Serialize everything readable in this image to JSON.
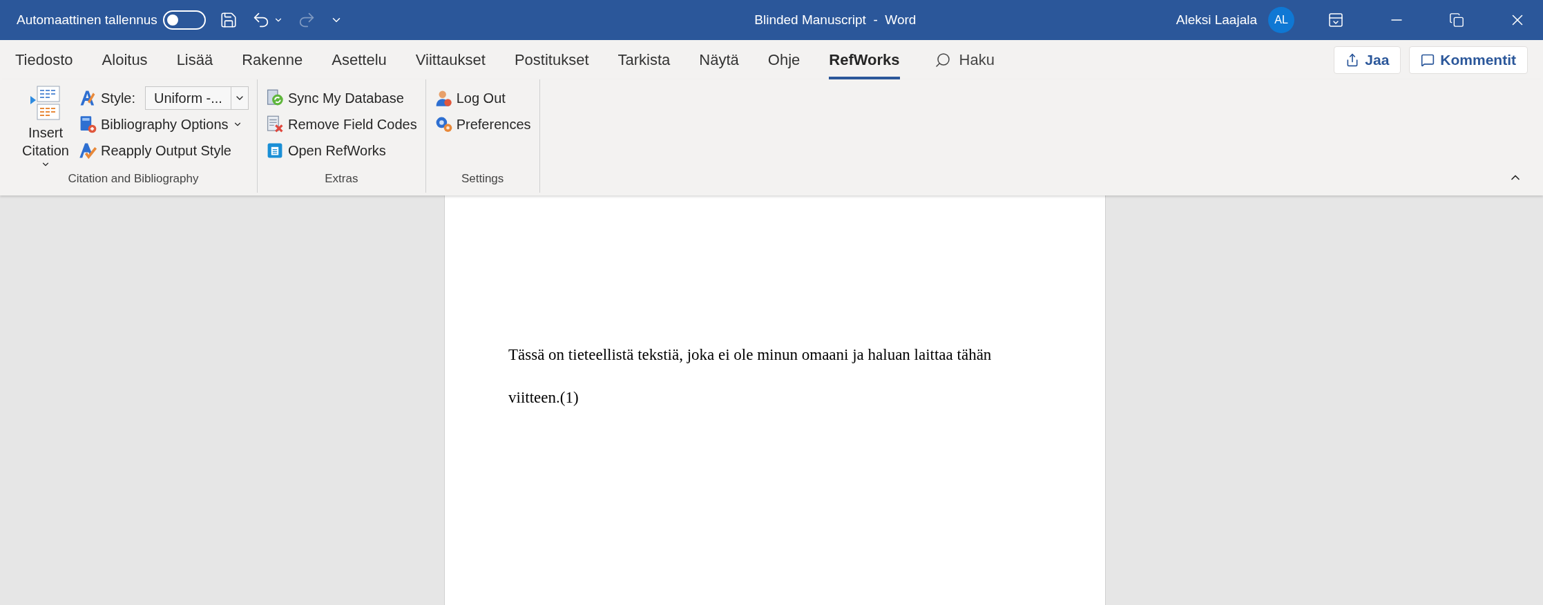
{
  "title_bar": {
    "autosave_label": "Automaattinen tallennus",
    "autosave_on": false,
    "document_title": "Blinded Manuscript  -  Word",
    "user_name": "Aleksi Laajala",
    "avatar_initials": "AL"
  },
  "tabs": [
    {
      "label": "Tiedosto",
      "selected": false
    },
    {
      "label": "Aloitus",
      "selected": false
    },
    {
      "label": "Lisää",
      "selected": false
    },
    {
      "label": "Rakenne",
      "selected": false
    },
    {
      "label": "Asettelu",
      "selected": false
    },
    {
      "label": "Viittaukset",
      "selected": false
    },
    {
      "label": "Postitukset",
      "selected": false
    },
    {
      "label": "Tarkista",
      "selected": false
    },
    {
      "label": "Näytä",
      "selected": false
    },
    {
      "label": "Ohje",
      "selected": false
    },
    {
      "label": "RefWorks",
      "selected": true
    }
  ],
  "search": {
    "placeholder": "Haku"
  },
  "share_button": "Jaa",
  "comments_button": "Kommentit",
  "ribbon_groups": [
    {
      "label": "Citation and Bibliography",
      "items": [
        {
          "kind": "large",
          "label": "Insert Citation"
        },
        {
          "kind": "select",
          "label": "Style:",
          "value": "Uniform -..."
        },
        {
          "kind": "menu",
          "label": "Bibliography Options"
        },
        {
          "kind": "button",
          "label": "Reapply Output Style"
        }
      ]
    },
    {
      "label": "Extras",
      "items": [
        {
          "kind": "button",
          "label": "Sync My Database"
        },
        {
          "kind": "button",
          "label": "Remove Field Codes"
        },
        {
          "kind": "button",
          "label": "Open RefWorks"
        }
      ]
    },
    {
      "label": "Settings",
      "items": [
        {
          "kind": "button",
          "label": "Log Out"
        },
        {
          "kind": "button",
          "label": "Preferences"
        }
      ]
    }
  ],
  "document": {
    "paragraph": "Tässä on tieteellistä tekstiä, joka ei ole minun omaani ja haluan laittaa tähän viitteen.(1)"
  }
}
